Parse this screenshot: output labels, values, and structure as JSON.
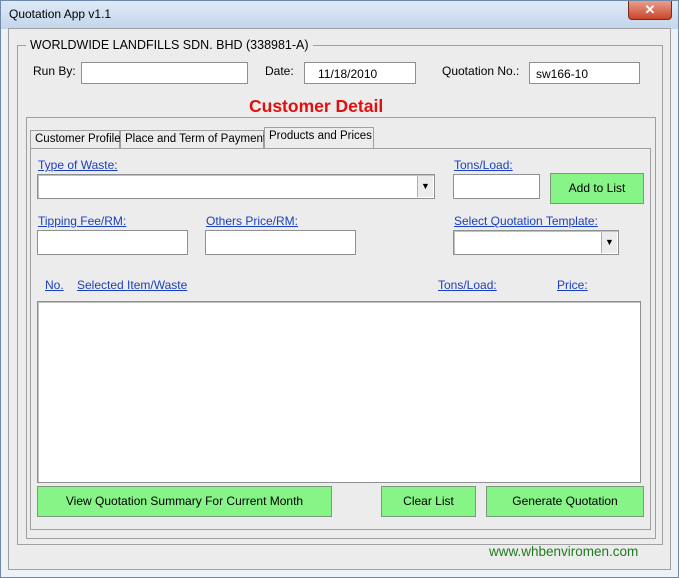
{
  "window": {
    "title": "Quotation App v1.1",
    "close_glyph": "✕"
  },
  "company": {
    "name": "WORLDWIDE LANDFILLS SDN. BHD (338981-A)"
  },
  "header": {
    "run_by_label": "Run By:",
    "run_by_value": "",
    "date_label": "Date:",
    "date_value": "11/18/2010",
    "quotation_no_label": "Quotation No.:",
    "quotation_no_value": "sw166-10"
  },
  "section_heading": "Customer Detail",
  "tabs": [
    {
      "label": "Customer Profile",
      "active": false
    },
    {
      "label": "Place and Term of Payment",
      "active": false
    },
    {
      "label": "Products and Prices",
      "active": true
    }
  ],
  "products": {
    "type_of_waste_label": "Type of Waste:",
    "type_of_waste_value": "",
    "tons_load_label": "Tons/Load:",
    "tons_load_value": "",
    "add_to_list_label": "Add to List",
    "tipping_fee_label": "Tipping Fee/RM:",
    "tipping_fee_value": "",
    "others_price_label": "Others Price/RM:",
    "others_price_value": "",
    "select_template_label": "Select Quotation Template:",
    "select_template_value": "",
    "list_headers": {
      "no": "No.",
      "item": "Selected Item/Waste",
      "tons": "Tons/Load:",
      "price": "Price:"
    },
    "list_items": []
  },
  "buttons": {
    "view_summary": "View Quotation Summary For Current Month",
    "clear_list": "Clear List",
    "generate": "Generate Quotation"
  },
  "footer": {
    "website": "www.whbenviromen.com"
  },
  "icons": {
    "dropdown": "chevron-down-icon"
  },
  "colors": {
    "heading": "#e01010",
    "button_green": "#86f486",
    "link_blue": "#1a3fbf",
    "footer_green": "#1f7a1f"
  }
}
